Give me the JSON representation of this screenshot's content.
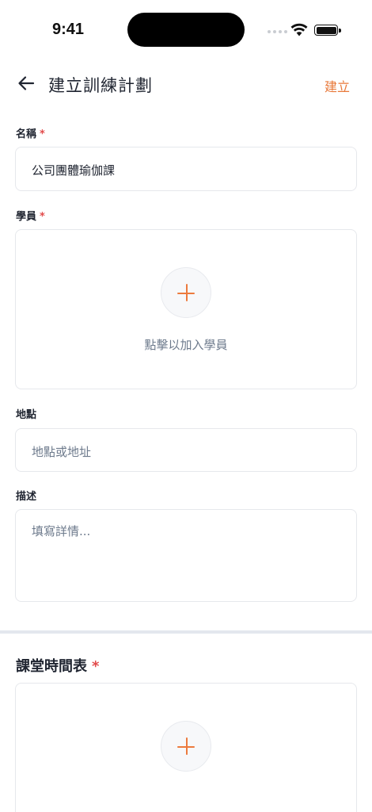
{
  "status_bar": {
    "time": "9:41"
  },
  "nav": {
    "back_icon": "arrow-left-icon",
    "title": "建立訓練計劃",
    "action_label": "建立"
  },
  "form": {
    "name": {
      "label": "名稱",
      "required_mark": "*",
      "value": "公司團體瑜伽課"
    },
    "students": {
      "label": "學員",
      "required_mark": "*",
      "add_icon": "plus-icon",
      "hint": "點擊以加入學員"
    },
    "location": {
      "label": "地點",
      "placeholder": "地點或地址"
    },
    "description": {
      "label": "描述",
      "placeholder": "填寫詳情..."
    }
  },
  "schedule": {
    "title": "課堂時間表",
    "required_mark": "*",
    "add_icon": "plus-icon"
  },
  "colors": {
    "accent": "#e8793a",
    "required": "#e24b4b",
    "text": "#1f2430",
    "placeholder": "#6d7a8c",
    "border": "#e6e8ec"
  }
}
